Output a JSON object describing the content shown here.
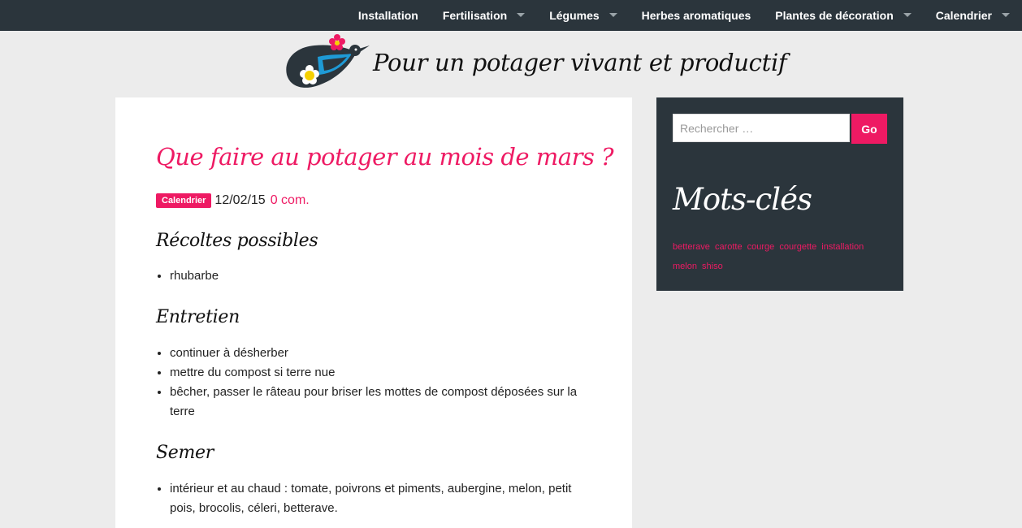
{
  "nav": {
    "items": [
      {
        "label": "Installation",
        "has_dropdown": false
      },
      {
        "label": "Fertilisation",
        "has_dropdown": true
      },
      {
        "label": "Légumes",
        "has_dropdown": true
      },
      {
        "label": "Herbes aromatiques",
        "has_dropdown": false
      },
      {
        "label": "Plantes de décoration",
        "has_dropdown": true
      },
      {
        "label": "Calendrier",
        "has_dropdown": true
      }
    ]
  },
  "site": {
    "title": "Pour un potager vivant et productif"
  },
  "post": {
    "title": "Que faire au potager au mois de mars ?",
    "category": "Calendrier",
    "date": "12/02/15",
    "comments": "0 com.",
    "sections": [
      {
        "heading": "Récoltes possibles",
        "items": [
          "rhubarbe"
        ]
      },
      {
        "heading": "Entretien",
        "items": [
          "continuer à désherber",
          "mettre du compost si terre nue",
          "bêcher, passer le râteau pour briser les mottes de compost déposées sur la terre"
        ]
      },
      {
        "heading": "Semer",
        "items": [
          "intérieur et au chaud : tomate, poivrons et piments, aubergine, melon, petit pois, brocolis, céleri, betterave."
        ]
      }
    ]
  },
  "sidebar": {
    "search_placeholder": "Rechercher …",
    "go_label": "Go",
    "tags_title": "Mots-clés",
    "tags": [
      "betterave",
      "carotte",
      "courge",
      "courgette",
      "installation",
      "melon",
      "shiso"
    ]
  },
  "colors": {
    "accent": "#ee1a63",
    "dark": "#2b353c",
    "background": "#ececec"
  },
  "icons": [
    "logo-bird-icon",
    "caret-down-icon"
  ]
}
